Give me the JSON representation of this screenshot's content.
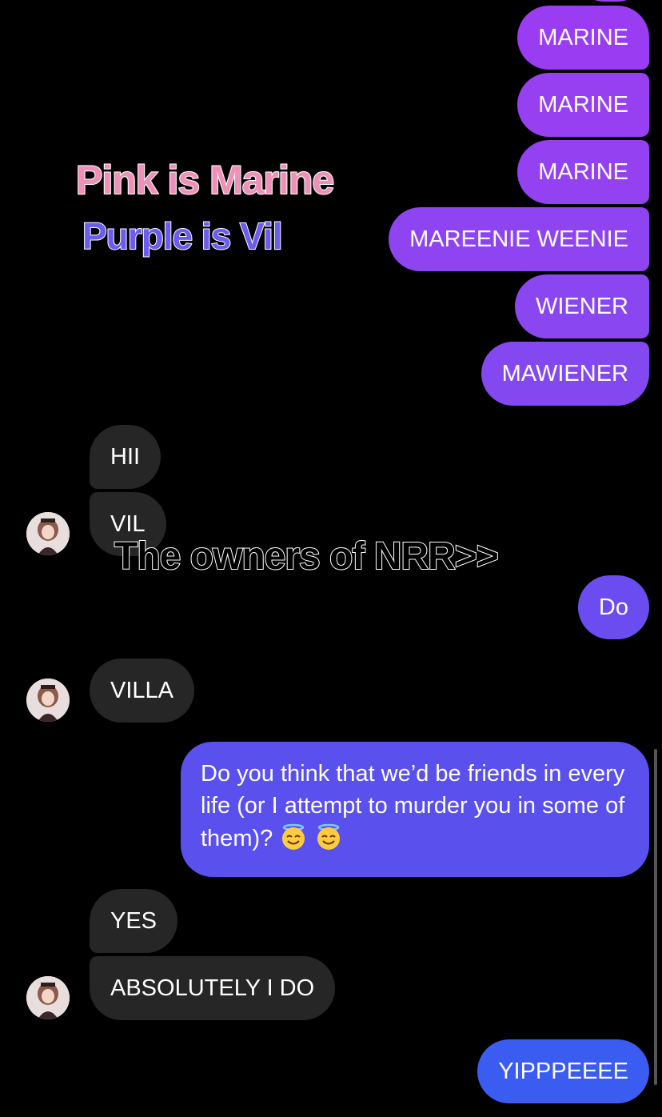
{
  "overlay": {
    "pink_caption": "Pink is Marine",
    "purple_caption": "Purple is Vil",
    "owners_caption": "The owners of NRR>>"
  },
  "messages": {
    "m1": "MARINE",
    "m2": "MARINE",
    "m3": "MARINE",
    "m4": "MAREENIE WEENIE",
    "m5": "WIENER",
    "m6": "MAWIENER",
    "r1": "HII",
    "r2": "VIL",
    "s1": "Do",
    "r3": "VILLA",
    "s2": "Do you think that we’d be friends in every life (or I attempt to murder you in some of them)?",
    "r4": "YES",
    "r5": "ABSOLUTELY I DO",
    "s3": "YIPPPEEEE"
  },
  "colors": {
    "sent_top": "#9b3ff0",
    "sent_mid": "#5a4df0",
    "sent_bottom": "#3a5ef0",
    "received": "#262626",
    "background": "#000000"
  },
  "icons": {
    "avatar": "user-avatar",
    "emoji": "smiling-face-with-halo"
  }
}
